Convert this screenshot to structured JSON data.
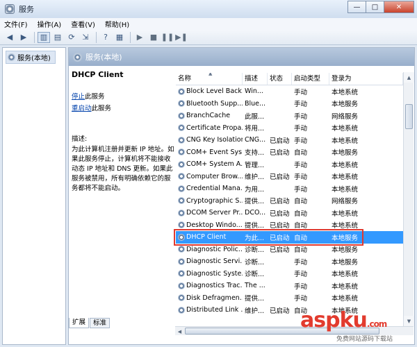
{
  "window": {
    "title": "服务",
    "min_label": "—",
    "max_label": "□",
    "close_label": "✕"
  },
  "menu": [
    "文件(F)",
    "操作(A)",
    "查看(V)",
    "帮助(H)"
  ],
  "toolbar": {
    "icons": [
      "back-icon",
      "forward-icon",
      "console-tree-icon",
      "properties-icon",
      "refresh-icon",
      "export-icon",
      "help-icon",
      "filter-icon",
      "start-icon",
      "stop-icon",
      "pause-icon",
      "restart-icon"
    ]
  },
  "tree": {
    "root": "服务(本地)"
  },
  "panel": {
    "header": "服务(本地)",
    "service_title": "DHCP Client",
    "stop_link": "停止",
    "stop_suffix": "此服务",
    "restart_link": "重启动",
    "restart_suffix": "此服务",
    "desc_label": "描述:",
    "description": "为此计算机注册并更新 IP 地址。如果此服务停止，计算机将不能接收动态 IP 地址和 DNS 更新。如果此服务被禁用，所有明确依赖它的服务都将不能启动。"
  },
  "list": {
    "columns": [
      "名称",
      "描述",
      "状态",
      "启动类型",
      "登录为"
    ],
    "rows": [
      {
        "name": "Block Level Back...",
        "desc": "Win...",
        "status": "",
        "start": "手动",
        "login": "本地系统",
        "selected": false
      },
      {
        "name": "Bluetooth Supp...",
        "desc": "Blue...",
        "status": "",
        "start": "手动",
        "login": "本地服务",
        "selected": false
      },
      {
        "name": "BranchCache",
        "desc": "此服...",
        "status": "",
        "start": "手动",
        "login": "网络服务",
        "selected": false
      },
      {
        "name": "Certificate Propa...",
        "desc": "将用...",
        "status": "",
        "start": "手动",
        "login": "本地系统",
        "selected": false
      },
      {
        "name": "CNG Key Isolation",
        "desc": "CNG...",
        "status": "已启动",
        "start": "手动",
        "login": "本地系统",
        "selected": false
      },
      {
        "name": "COM+ Event Sys...",
        "desc": "支持...",
        "status": "已启动",
        "start": "自动",
        "login": "本地服务",
        "selected": false
      },
      {
        "name": "COM+ System A...",
        "desc": "管理...",
        "status": "",
        "start": "手动",
        "login": "本地系统",
        "selected": false
      },
      {
        "name": "Computer Brow...",
        "desc": "维护...",
        "status": "已启动",
        "start": "手动",
        "login": "本地系统",
        "selected": false
      },
      {
        "name": "Credential Mana...",
        "desc": "为用...",
        "status": "",
        "start": "手动",
        "login": "本地系统",
        "selected": false
      },
      {
        "name": "Cryptographic S...",
        "desc": "提供...",
        "status": "已启动",
        "start": "自动",
        "login": "网络服务",
        "selected": false
      },
      {
        "name": "DCOM Server Pr...",
        "desc": "DCO...",
        "status": "已启动",
        "start": "自动",
        "login": "本地系统",
        "selected": false
      },
      {
        "name": "Desktop Windo...",
        "desc": "提供...",
        "status": "已启动",
        "start": "自动",
        "login": "本地系统",
        "selected": false
      },
      {
        "name": "DHCP Client",
        "desc": "为此...",
        "status": "已启动",
        "start": "自动",
        "login": "本地服务",
        "selected": true
      },
      {
        "name": "Diagnostic Polic...",
        "desc": "诊断...",
        "status": "已启动",
        "start": "自动",
        "login": "本地服务",
        "selected": false
      },
      {
        "name": "Diagnostic Servi...",
        "desc": "诊断...",
        "status": "",
        "start": "手动",
        "login": "本地服务",
        "selected": false
      },
      {
        "name": "Diagnostic Syste...",
        "desc": "诊断...",
        "status": "",
        "start": "手动",
        "login": "本地系统",
        "selected": false
      },
      {
        "name": "Diagnostics Trac...",
        "desc": "The ...",
        "status": "",
        "start": "手动",
        "login": "本地系统",
        "selected": false
      },
      {
        "name": "Disk Defragmen...",
        "desc": "提供...",
        "status": "",
        "start": "手动",
        "login": "本地系统",
        "selected": false
      },
      {
        "name": "Distributed Link ...",
        "desc": "维护...",
        "status": "已启动",
        "start": "自动",
        "login": "本地系统",
        "selected": false
      }
    ]
  },
  "tabs": [
    "扩展",
    "标准"
  ],
  "watermark": {
    "logo": "aspku",
    "suffix": ".com",
    "sub": "免费网站源码下载站"
  }
}
